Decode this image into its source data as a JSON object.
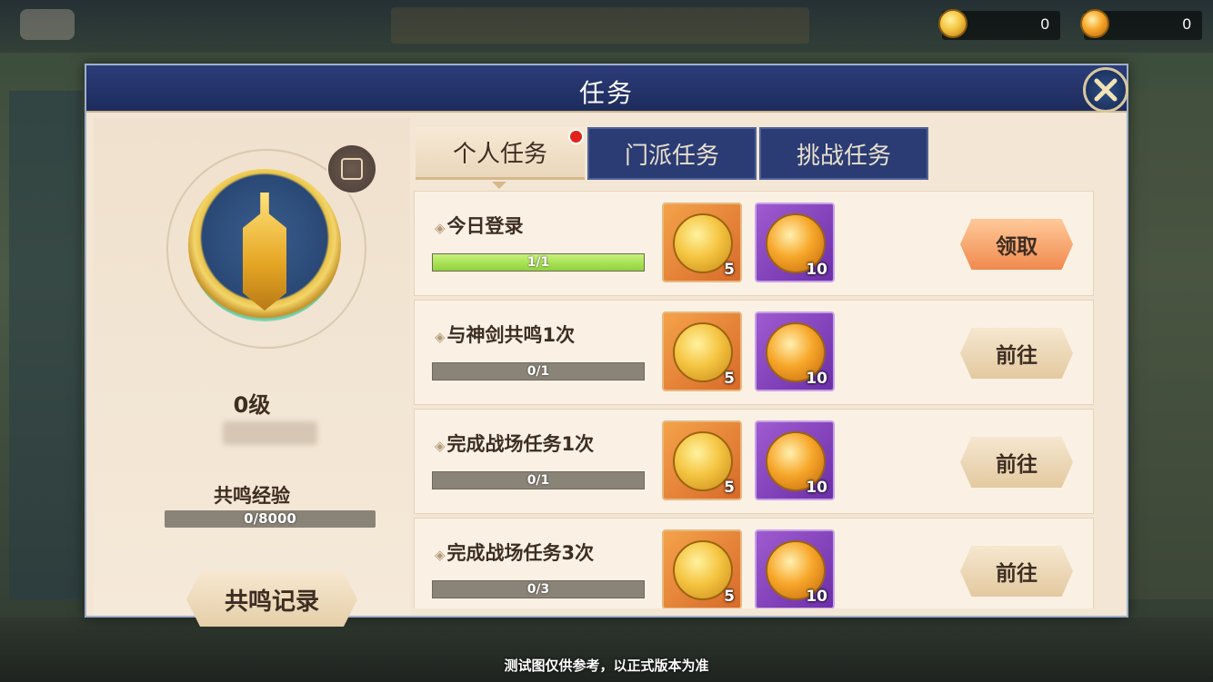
{
  "currency": [
    {
      "icon": "gold-coin-icon",
      "amount": "0"
    },
    {
      "icon": "flame-coin-icon",
      "amount": "0"
    }
  ],
  "dialog": {
    "title": "任务"
  },
  "profile": {
    "level": "0级",
    "exp_label": "共鸣经验",
    "exp_text": "0/8000",
    "record_button": "共鸣记录"
  },
  "tabs": [
    {
      "label": "个人任务",
      "active": true,
      "has_notification": true
    },
    {
      "label": "门派任务",
      "active": false
    },
    {
      "label": "挑战任务",
      "active": false
    }
  ],
  "tasks": [
    {
      "title": "今日登录",
      "progress_text": "1/1",
      "progress": 1.0,
      "rewards": [
        {
          "type": "gold-medal",
          "count": "5"
        },
        {
          "type": "flame-medal",
          "count": "10"
        }
      ],
      "button": "领取"
    },
    {
      "title": "与神剑共鸣1次",
      "progress_text": "0/1",
      "progress": 0,
      "rewards": [
        {
          "type": "gold-medal",
          "count": "5"
        },
        {
          "type": "flame-medal",
          "count": "10"
        }
      ],
      "button": "前往"
    },
    {
      "title": "完成战场任务1次",
      "progress_text": "0/1",
      "progress": 0,
      "rewards": [
        {
          "type": "gold-medal",
          "count": "5"
        },
        {
          "type": "flame-medal",
          "count": "10"
        }
      ],
      "button": "前往"
    },
    {
      "title": "完成战场任务3次",
      "progress_text": "0/3",
      "progress": 0,
      "rewards": [
        {
          "type": "gold-medal",
          "count": "5"
        },
        {
          "type": "flame-medal",
          "count": "10"
        }
      ],
      "button": "前往"
    }
  ],
  "footer_note": "测试图仅供参考，以正式版本为准",
  "colors": {
    "header": "#1e2c5c",
    "panel": "#f3e6d4",
    "progress_fill": "#8fd33a",
    "claim_button": "#f08a4e"
  }
}
